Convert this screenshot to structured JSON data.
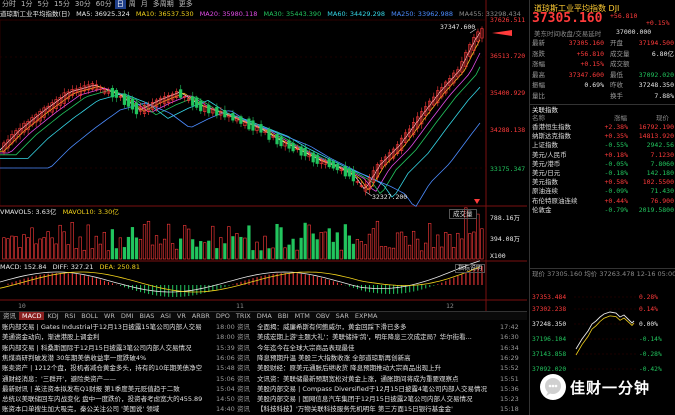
{
  "header": {
    "period_tabs": [
      "分时",
      "1分",
      "5分",
      "15分",
      "30分",
      "60分",
      "日",
      "周",
      "月",
      "多周期",
      "更多"
    ],
    "active_period": "日"
  },
  "ma_legend": {
    "name": "道琼斯工业平均指数(日)",
    "ma5": "MA5: 36925.324",
    "ma10": "MA10: 36537.530",
    "ma20": "MA20: 35980.118",
    "ma30": "MA30: 35443.390",
    "ma60": "MA60: 34429.298",
    "ma250": "MA250: 33962.988",
    "ma455": "MA455: 33298.434"
  },
  "colors": {
    "up": "#ff3b3b",
    "down": "#22c55e",
    "ma5": "#e8e8e8",
    "ma10": "#f2d21b",
    "ma20": "#e24be6",
    "ma30": "#22c55e",
    "ma60": "#35d6e6",
    "ma250": "#4c8cff",
    "ma455": "#8a8a8a"
  },
  "price_axis": [
    "37626.511",
    "36513.720",
    "35400.929",
    "34288.138",
    "33175.347"
  ],
  "annotations": {
    "high": "37347.600",
    "low": "32327.200"
  },
  "volume": {
    "label": "VMAVOL5: 3.63亿",
    "mavol10": "MAVOL10: 3.30亿",
    "axis_top": "788.16万",
    "axis_mid": "394.08万",
    "axis_bottom": "X100",
    "unit_button": "成交量"
  },
  "macd": {
    "label": "MACD: 152.84",
    "diff": "DIFF: 327.21",
    "dea": "DEA: 250.81",
    "button": "指标说明"
  },
  "x_axis": [
    "10",
    "11",
    "12"
  ],
  "indicator_tabs": [
    "资讯",
    "MACD",
    "KDJ",
    "RSI",
    "BOLL",
    "WR",
    "DMI",
    "BIAS",
    "ASI",
    "VR",
    "ARBR",
    "DPO",
    "TRIX",
    "DMA",
    "BBI",
    "MTM",
    "OBV",
    "SAR",
    "EXPMA"
  ],
  "active_indicator": "MACD",
  "news": [
    {
      "t1": "账内部交易 | Gates Industrial于12月13日披露15笔公司内部人交易情况",
      "d1": "18:00",
      "s": "资讯",
      "t2": "全面揭：威廉希斯有何鲍威尔，黄金回踩下滑已多多",
      "d2": "17:42"
    },
    {
      "t1": "美通资金动向，渐进港股上调金利",
      "d1": "18:00",
      "s": "资讯",
      "t2": "美成宏期上游'主题大礼'：美联储持'鸽'，明年降息三次成定局？华尔街看...",
      "d2": "16:30"
    },
    {
      "t1": "账内部交易 | 科桑斯国际于12月15日披露3笔公司内部人交易情况",
      "d1": "15:39",
      "s": "资讯",
      "t2": "今年迄今在全球大宗商品表现最佳",
      "d2": "16:34"
    },
    {
      "t1": "焦煤商研判破发潜 30年期美债收益率一度跌破4%",
      "d1": "16:06",
      "s": "资讯",
      "t2": "降息预期升温 美股三大指数收涨 全部道琼斯再创新高",
      "d2": "16:29"
    },
    {
      "t1": "账卖资产 | 1212个盘，投机者减仓黄金多头，持有的10年期美债净空头头...",
      "d1": "15:48",
      "s": "资讯",
      "t2": "美股财经：原美元通胀后继收货 降息预期推动大宗商品出现上升",
      "d2": "15:52"
    },
    {
      "t1": "通财经消息：'三群开'，避险类资产——",
      "d1": "15:06",
      "s": "资讯",
      "t2": "文讯资：美联储最新预期宽松对黄金上涨，通胀期间将成为重要观察点",
      "d2": "15:51"
    },
    {
      "t1": "最新财讯 | 英法资本拟发布Q1财报 第1季度美元贬值趋于二致",
      "d1": "15:04",
      "s": "资讯",
      "t2": "美股内部交易 | Compass Diversified于12月15日披露4笔公司内部人交易情况",
      "d2": "15:36"
    },
    {
      "t1": "总统以美联储回车内战变化 盘中一度跌价，投资者考虑宽大的455.89%",
      "d1": "14:50",
      "s": "资讯",
      "t2": "美股内部交易 | 国网信息汽车集团于12月15日披露2笔公司内部人交易情况",
      "d2": "15:23"
    },
    {
      "t1": "账资本口单搜生加大吸完，秦公关注公司 '美国说' 领域",
      "d1": "14:40",
      "s": "资讯",
      "t2": "【科技科技】'万物关联科技服务先机明年 第三方面15日银行基金金'",
      "d2": "15:18"
    }
  ],
  "quote": {
    "title": "道琼斯工业平均指数 DJI",
    "price": "37305.160",
    "change": "+56.810",
    "pct": "+0.15%",
    "sub_label": "美东时间收盘/交易延时",
    "sub_value": "37000.000",
    "stats": [
      {
        "k1": "最新",
        "v1": "37305.160",
        "c1": "up",
        "k2": "开盘",
        "v2": "37194.500",
        "c2": "up"
      },
      {
        "k1": "涨跌",
        "v1": "+56.810",
        "c1": "up",
        "k2": "成交量",
        "v2": "6.80亿",
        "c2": "white"
      },
      {
        "k1": "涨幅",
        "v1": "+0.15%",
        "c1": "up",
        "k2": "成交额",
        "v2": "",
        "c2": "white"
      },
      {
        "k1": "最高",
        "v1": "37347.600",
        "c1": "up",
        "k2": "最低",
        "v2": "37092.020",
        "c2": "green"
      },
      {
        "k1": "振幅",
        "v1": "0.69%",
        "c1": "white",
        "k2": "昨收",
        "v2": "37248.350",
        "c2": "white"
      },
      {
        "k1": "量比",
        "v1": "",
        "c1": "white",
        "k2": "换手",
        "v2": "7.88%",
        "c2": "white"
      }
    ]
  },
  "related": {
    "title": "关联指数",
    "cols": [
      "名称",
      "涨幅",
      "现价"
    ],
    "rows": [
      {
        "n": "香港恒生指数",
        "c": "+2.38%",
        "p": "16792.190",
        "dir": "up"
      },
      {
        "n": "纳斯达克指数",
        "c": "+0.35%",
        "p": "14813.920",
        "dir": "up"
      },
      {
        "n": "上证指数",
        "c": "-0.55%",
        "p": "2942.56",
        "dir": "down"
      },
      {
        "n": "美元/人民币",
        "c": "+0.18%",
        "p": "7.1230",
        "dir": "up"
      },
      {
        "n": "美元/港币",
        "c": "-0.05%",
        "p": "7.8060",
        "dir": "down"
      },
      {
        "n": "美元/日元",
        "c": "-0.18%",
        "p": "142.180",
        "dir": "down"
      },
      {
        "n": "美元指数",
        "c": "+0.58%",
        "p": "102.5500",
        "dir": "up"
      },
      {
        "n": "原油连续",
        "c": "-0.09%",
        "p": "71.430",
        "dir": "down"
      },
      {
        "n": "布伦特原油连续",
        "c": "+0.44%",
        "p": "76.900",
        "dir": "up"
      },
      {
        "n": "伦敦金",
        "c": "-0.79%",
        "p": "2019.5800",
        "dir": "down"
      }
    ]
  },
  "mini_chart": {
    "header": "现价 37305.160  均价 37263.478    12-16 05:00",
    "axis": [
      "37353.484",
      "37302.238",
      "37248.350",
      "37196.104",
      "37143.858",
      "37092.020"
    ],
    "pct_axis": [
      "0.28%",
      "0.14%",
      "0.00%",
      "-0.14%",
      "-0.28%",
      "-0.42%"
    ]
  },
  "watermark": "佳财一分钟"
}
